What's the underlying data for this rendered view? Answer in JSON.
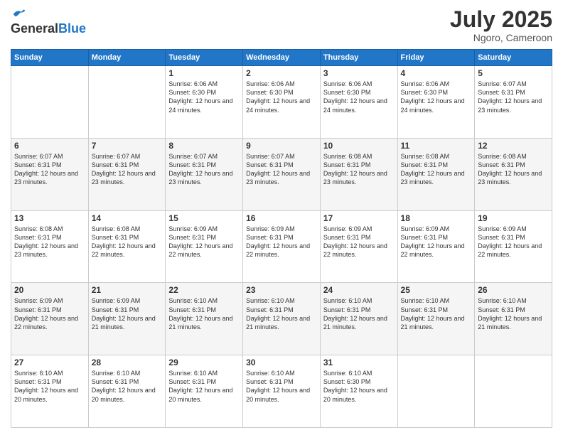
{
  "logo": {
    "general": "General",
    "blue": "Blue"
  },
  "title": {
    "month": "July 2025",
    "location": "Ngoro, Cameroon"
  },
  "days_header": [
    "Sunday",
    "Monday",
    "Tuesday",
    "Wednesday",
    "Thursday",
    "Friday",
    "Saturday"
  ],
  "weeks": [
    {
      "days": [
        {
          "num": "",
          "info": ""
        },
        {
          "num": "",
          "info": ""
        },
        {
          "num": "1",
          "info": "Sunrise: 6:06 AM\nSunset: 6:30 PM\nDaylight: 12 hours and 24 minutes."
        },
        {
          "num": "2",
          "info": "Sunrise: 6:06 AM\nSunset: 6:30 PM\nDaylight: 12 hours and 24 minutes."
        },
        {
          "num": "3",
          "info": "Sunrise: 6:06 AM\nSunset: 6:30 PM\nDaylight: 12 hours and 24 minutes."
        },
        {
          "num": "4",
          "info": "Sunrise: 6:06 AM\nSunset: 6:30 PM\nDaylight: 12 hours and 24 minutes."
        },
        {
          "num": "5",
          "info": "Sunrise: 6:07 AM\nSunset: 6:31 PM\nDaylight: 12 hours and 23 minutes."
        }
      ]
    },
    {
      "days": [
        {
          "num": "6",
          "info": "Sunrise: 6:07 AM\nSunset: 6:31 PM\nDaylight: 12 hours and 23 minutes."
        },
        {
          "num": "7",
          "info": "Sunrise: 6:07 AM\nSunset: 6:31 PM\nDaylight: 12 hours and 23 minutes."
        },
        {
          "num": "8",
          "info": "Sunrise: 6:07 AM\nSunset: 6:31 PM\nDaylight: 12 hours and 23 minutes."
        },
        {
          "num": "9",
          "info": "Sunrise: 6:07 AM\nSunset: 6:31 PM\nDaylight: 12 hours and 23 minutes."
        },
        {
          "num": "10",
          "info": "Sunrise: 6:08 AM\nSunset: 6:31 PM\nDaylight: 12 hours and 23 minutes."
        },
        {
          "num": "11",
          "info": "Sunrise: 6:08 AM\nSunset: 6:31 PM\nDaylight: 12 hours and 23 minutes."
        },
        {
          "num": "12",
          "info": "Sunrise: 6:08 AM\nSunset: 6:31 PM\nDaylight: 12 hours and 23 minutes."
        }
      ]
    },
    {
      "days": [
        {
          "num": "13",
          "info": "Sunrise: 6:08 AM\nSunset: 6:31 PM\nDaylight: 12 hours and 23 minutes."
        },
        {
          "num": "14",
          "info": "Sunrise: 6:08 AM\nSunset: 6:31 PM\nDaylight: 12 hours and 22 minutes."
        },
        {
          "num": "15",
          "info": "Sunrise: 6:09 AM\nSunset: 6:31 PM\nDaylight: 12 hours and 22 minutes."
        },
        {
          "num": "16",
          "info": "Sunrise: 6:09 AM\nSunset: 6:31 PM\nDaylight: 12 hours and 22 minutes."
        },
        {
          "num": "17",
          "info": "Sunrise: 6:09 AM\nSunset: 6:31 PM\nDaylight: 12 hours and 22 minutes."
        },
        {
          "num": "18",
          "info": "Sunrise: 6:09 AM\nSunset: 6:31 PM\nDaylight: 12 hours and 22 minutes."
        },
        {
          "num": "19",
          "info": "Sunrise: 6:09 AM\nSunset: 6:31 PM\nDaylight: 12 hours and 22 minutes."
        }
      ]
    },
    {
      "days": [
        {
          "num": "20",
          "info": "Sunrise: 6:09 AM\nSunset: 6:31 PM\nDaylight: 12 hours and 22 minutes."
        },
        {
          "num": "21",
          "info": "Sunrise: 6:09 AM\nSunset: 6:31 PM\nDaylight: 12 hours and 21 minutes."
        },
        {
          "num": "22",
          "info": "Sunrise: 6:10 AM\nSunset: 6:31 PM\nDaylight: 12 hours and 21 minutes."
        },
        {
          "num": "23",
          "info": "Sunrise: 6:10 AM\nSunset: 6:31 PM\nDaylight: 12 hours and 21 minutes."
        },
        {
          "num": "24",
          "info": "Sunrise: 6:10 AM\nSunset: 6:31 PM\nDaylight: 12 hours and 21 minutes."
        },
        {
          "num": "25",
          "info": "Sunrise: 6:10 AM\nSunset: 6:31 PM\nDaylight: 12 hours and 21 minutes."
        },
        {
          "num": "26",
          "info": "Sunrise: 6:10 AM\nSunset: 6:31 PM\nDaylight: 12 hours and 21 minutes."
        }
      ]
    },
    {
      "days": [
        {
          "num": "27",
          "info": "Sunrise: 6:10 AM\nSunset: 6:31 PM\nDaylight: 12 hours and 20 minutes."
        },
        {
          "num": "28",
          "info": "Sunrise: 6:10 AM\nSunset: 6:31 PM\nDaylight: 12 hours and 20 minutes."
        },
        {
          "num": "29",
          "info": "Sunrise: 6:10 AM\nSunset: 6:31 PM\nDaylight: 12 hours and 20 minutes."
        },
        {
          "num": "30",
          "info": "Sunrise: 6:10 AM\nSunset: 6:31 PM\nDaylight: 12 hours and 20 minutes."
        },
        {
          "num": "31",
          "info": "Sunrise: 6:10 AM\nSunset: 6:30 PM\nDaylight: 12 hours and 20 minutes."
        },
        {
          "num": "",
          "info": ""
        },
        {
          "num": "",
          "info": ""
        }
      ]
    }
  ]
}
